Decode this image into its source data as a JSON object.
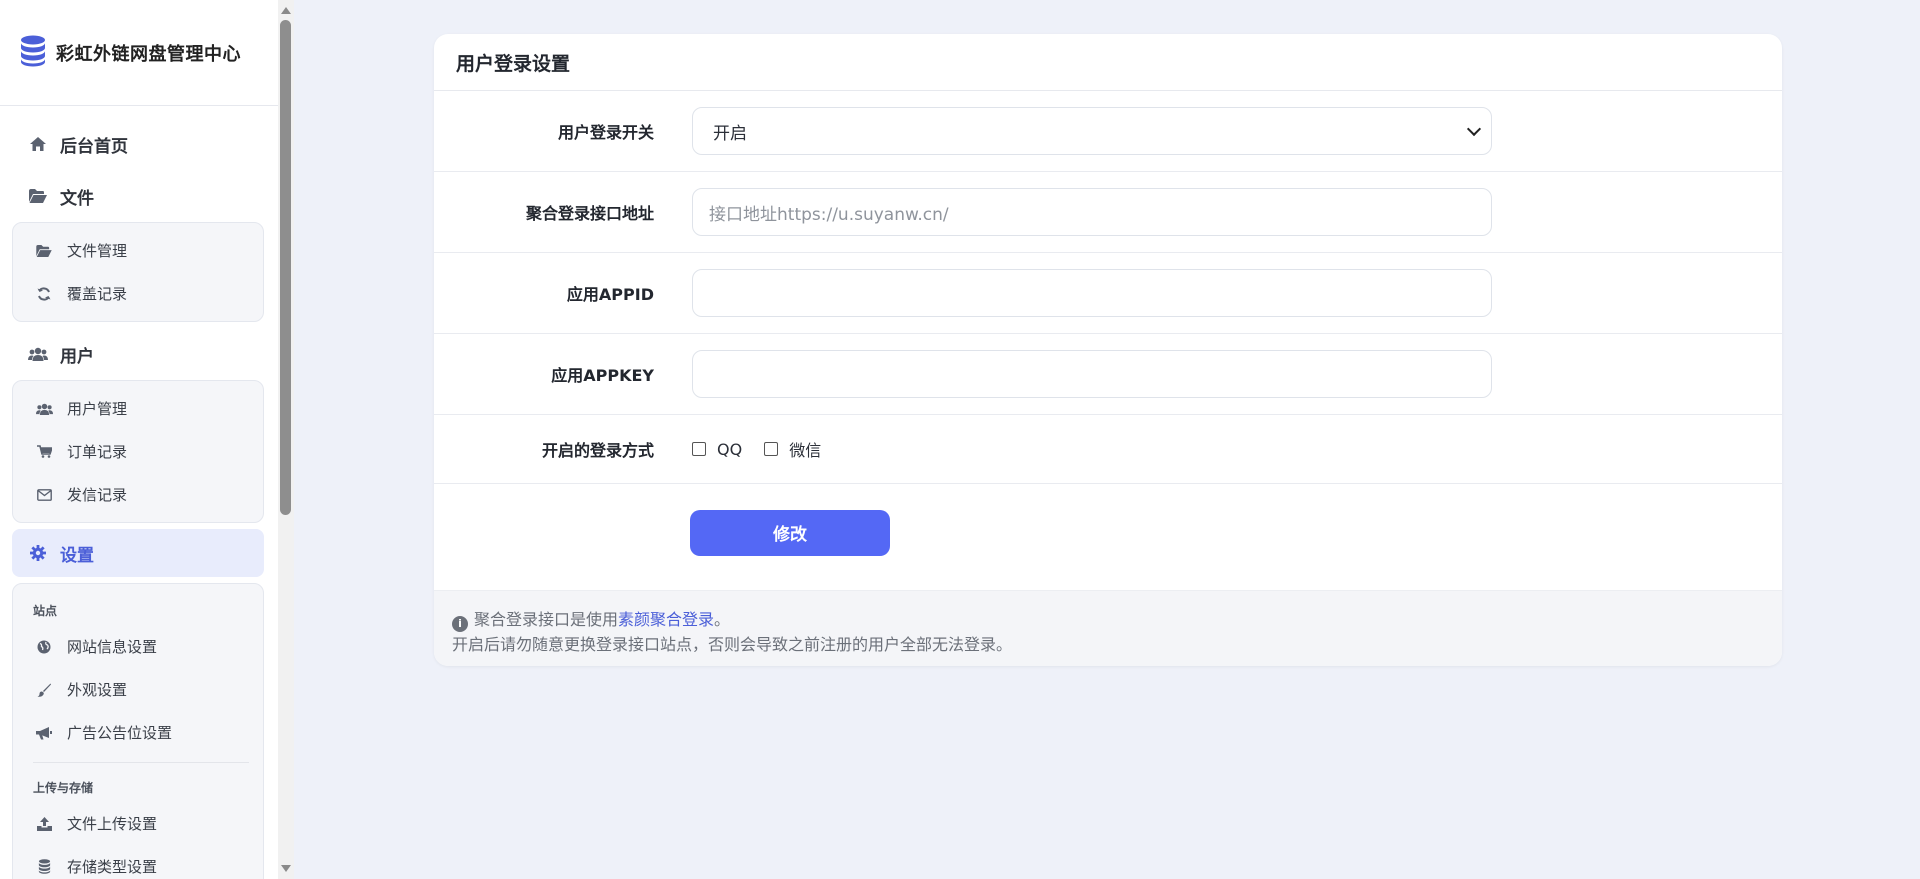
{
  "brand": {
    "title": "彩虹外链网盘管理中心"
  },
  "nav": {
    "home": "后台首页",
    "files": {
      "label": "文件",
      "items": [
        "文件管理",
        "覆盖记录"
      ]
    },
    "users": {
      "label": "用户",
      "items": [
        "用户管理",
        "订单记录",
        "发信记录"
      ]
    },
    "settings": {
      "label": "设置",
      "group_site": "站点",
      "site_items": [
        "网站信息设置",
        "外观设置",
        "广告公告位设置"
      ],
      "group_upload": "上传与存储",
      "upload_items": [
        "文件上传设置",
        "存储类型设置"
      ]
    }
  },
  "form": {
    "title": "用户登录设置",
    "login_switch_label": "用户登录开关",
    "login_switch_value": "开启",
    "api_url_label": "聚合登录接口地址",
    "api_url_placeholder": "接口地址https://u.suyanw.cn/",
    "api_url_value": "",
    "appid_label": "应用APPID",
    "appid_value": "",
    "appkey_label": "应用APPKEY",
    "appkey_value": "",
    "methods_label": "开启的登录方式",
    "method_qq": "QQ",
    "method_wechat": "微信",
    "submit_label": "修改"
  },
  "footer": {
    "line1_prefix": "聚合登录接口是使用",
    "line1_link": "素颜聚合登录",
    "line1_suffix": "。",
    "line2": "开启后请勿随意更换登录接口站点，否则会导致之前注册的用户全部无法登录。"
  },
  "colors": {
    "accent": "#5468f5",
    "page_bg": "#eef1f9",
    "active_nav_bg": "#e8ecfc"
  }
}
